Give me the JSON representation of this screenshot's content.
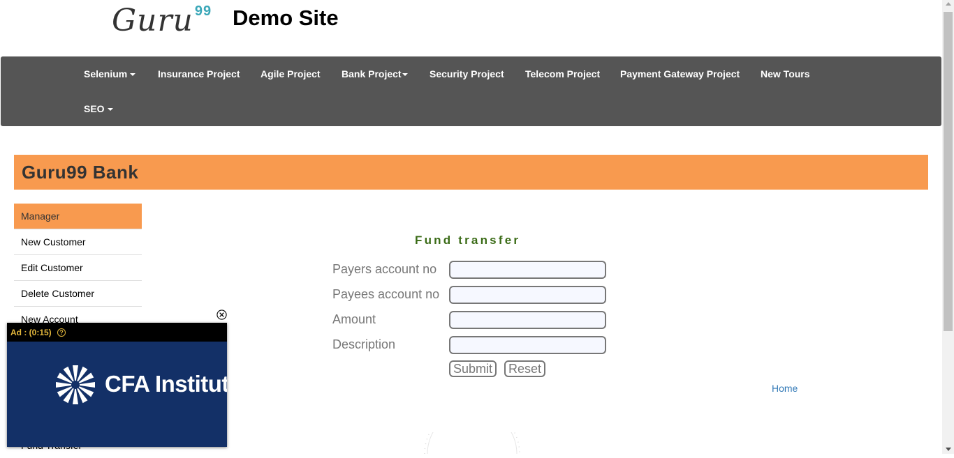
{
  "header": {
    "logo_text": "Guru",
    "logo_sup": "99",
    "site_title": "Demo Site"
  },
  "navbar": {
    "items": [
      {
        "label": "Selenium",
        "dropdown": true
      },
      {
        "label": "Insurance Project",
        "dropdown": false
      },
      {
        "label": "Agile Project",
        "dropdown": false
      },
      {
        "label": "Bank Project",
        "dropdown": true
      },
      {
        "label": "Security Project",
        "dropdown": false
      },
      {
        "label": "Telecom Project",
        "dropdown": false
      },
      {
        "label": "Payment Gateway Project",
        "dropdown": false
      },
      {
        "label": "New Tours",
        "dropdown": false
      },
      {
        "label": "SEO",
        "dropdown": true
      }
    ]
  },
  "bank": {
    "title": "Guru99 Bank"
  },
  "sidebar": {
    "items": [
      {
        "label": "Manager",
        "active": true
      },
      {
        "label": "New Customer"
      },
      {
        "label": "Edit Customer"
      },
      {
        "label": "Delete Customer"
      },
      {
        "label": "New Account"
      },
      {
        "label": "Fund Transfer"
      }
    ]
  },
  "form": {
    "heading": "Fund transfer",
    "fields": [
      {
        "label": "Payers account no",
        "value": ""
      },
      {
        "label": "Payees account no",
        "value": ""
      },
      {
        "label": "Amount",
        "value": ""
      },
      {
        "label": "Description",
        "value": ""
      }
    ],
    "submit_label": "Submit",
    "reset_label": "Reset",
    "home_link": "Home"
  },
  "ad": {
    "timer": "Ad : (0:15)",
    "help": "?",
    "brand_text": "CFA Institute"
  },
  "colors": {
    "navbar_bg": "#555555",
    "accent_orange": "#f89a4f",
    "heading_green": "#3a6b16",
    "ad_bg": "#133067",
    "ad_timer": "#e2b63b",
    "link_blue": "#337ab7"
  }
}
